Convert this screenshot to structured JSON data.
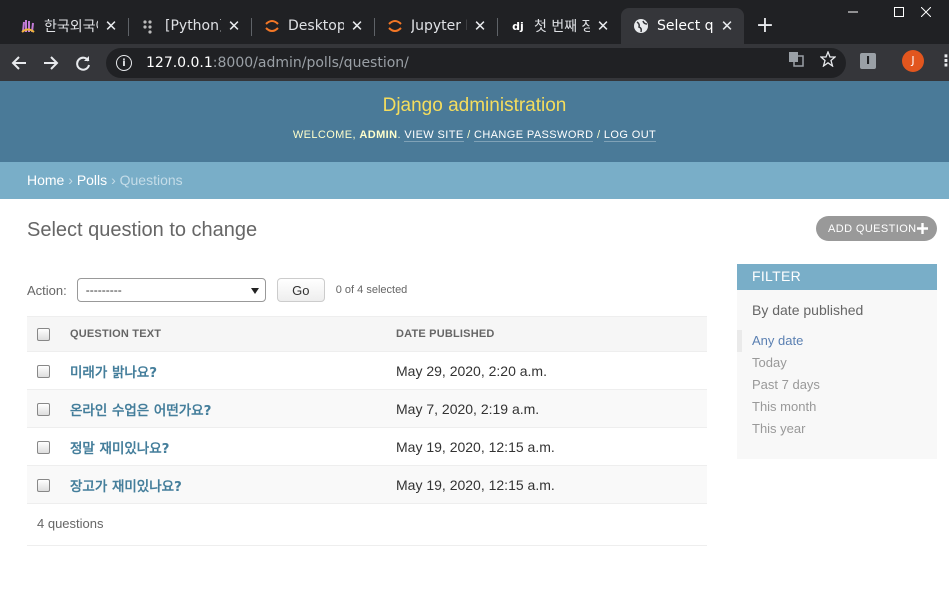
{
  "browser": {
    "tabs": [
      {
        "title": "한국외국어대학교",
        "icon": "hufs-icon",
        "active": false
      },
      {
        "title": "[Python] Django",
        "icon": "dots-icon",
        "active": false
      },
      {
        "title": "Desktop/",
        "icon": "jupyter-icon",
        "active": false
      },
      {
        "title": "Jupyter Notebook",
        "icon": "jupyter-icon",
        "active": false
      },
      {
        "title": "첫 번째 장고",
        "icon": "django-icon",
        "active": false
      },
      {
        "title": "Select question",
        "icon": "globe-icon",
        "active": true
      }
    ],
    "new_tab": "+",
    "url_host": "127.0.0.1",
    "url_path": ":8000/admin/polls/question/",
    "profile_initial": "J",
    "extension_label": "I"
  },
  "admin": {
    "branding": "Django administration",
    "welcome": "WELCOME, ",
    "username": "ADMIN",
    "view_site": "VIEW SITE",
    "change_password": "CHANGE PASSWORD",
    "log_out": "LOG OUT",
    "breadcrumb_home": "Home",
    "breadcrumb_app": "Polls",
    "breadcrumb_current": "Questions",
    "title": "Select question to change",
    "add_button": "ADD QUESTION",
    "action_label": "Action:",
    "action_value": "---------",
    "go_button": "Go",
    "selected_counter": "0 of 4 selected",
    "columns": [
      "QUESTION TEXT",
      "DATE PUBLISHED"
    ],
    "rows": [
      {
        "question": "미래가 밝나요?",
        "date": "May 29, 2020, 2:20 a.m."
      },
      {
        "question": "온라인 수업은 어떤가요?",
        "date": "May 7, 2020, 2:19 a.m."
      },
      {
        "question": "정말 재미있나요?",
        "date": "May 19, 2020, 12:15 a.m."
      },
      {
        "question": "장고가 재미있나요?",
        "date": "May 19, 2020, 12:15 a.m."
      }
    ],
    "count": "4 questions",
    "filter_title": "FILTER",
    "filter_by": "By date published",
    "filter_options": [
      "Any date",
      "Today",
      "Past 7 days",
      "This month",
      "This year"
    ]
  },
  "colors": {
    "header_bg": "#4a7a98",
    "branding": "#f5dd5d",
    "breadcrumb_bg": "#79aec8",
    "link": "#447e9b"
  }
}
